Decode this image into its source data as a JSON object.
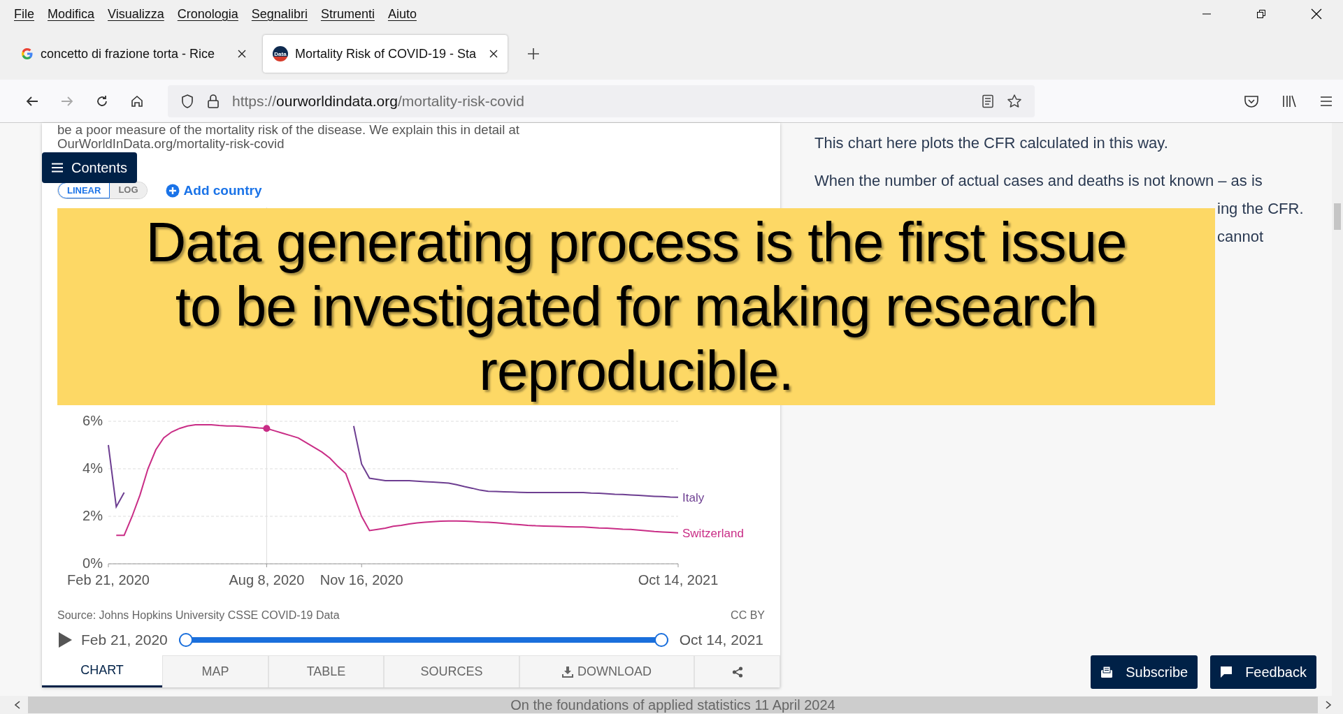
{
  "menu": [
    "File",
    "Modifica",
    "Visualizza",
    "Cronologia",
    "Segnalibri",
    "Strumenti",
    "Aiuto"
  ],
  "tabs": [
    {
      "title": "concetto di frazione torta - Rice",
      "selected": false
    },
    {
      "title": "Mortality Risk of COVID-19 - Sta",
      "selected": true,
      "favicon_text": "Data"
    }
  ],
  "address": {
    "scheme": "https://",
    "domain": "ourworldindata.org",
    "path": "/mortality-risk-covid"
  },
  "intro_lines": [
    "be a poor measure of the mortality risk of the disease. We explain this in detail at",
    "OurWorldInData.org/mortality-risk-covid"
  ],
  "contents_button": "Contents",
  "scale_toggle": [
    {
      "label": "LINEAR",
      "selected": true
    },
    {
      "label": "LOG",
      "selected": false
    }
  ],
  "add_country": "Add country",
  "chart_data": {
    "type": "line",
    "categories": [
      "Feb 21, 2020",
      null,
      null,
      null,
      null,
      null,
      null,
      null,
      null,
      null,
      null,
      null,
      null,
      null,
      null,
      null,
      null,
      null,
      null,
      null,
      "Aug 8, 2020",
      null,
      null,
      null,
      null,
      null,
      null,
      null,
      null,
      null,
      null,
      null,
      "Nov 16, 2020",
      null,
      null,
      null,
      null,
      null,
      null,
      null,
      null,
      null,
      null,
      null,
      null,
      null,
      null,
      null,
      null,
      null,
      null,
      null,
      null,
      null,
      null,
      null,
      null,
      null,
      null,
      null,
      null,
      null,
      null,
      null,
      null,
      null,
      null,
      null,
      null,
      null,
      null,
      null,
      "Oct 14, 2021"
    ],
    "yticks": [
      {
        "value": 0,
        "label": "0%"
      },
      {
        "value": 2,
        "label": "2%"
      },
      {
        "value": 4,
        "label": "4%"
      },
      {
        "value": 6,
        "label": "6%"
      }
    ],
    "ylim": [
      0,
      15
    ],
    "grid": true,
    "series": [
      {
        "name": "Italy",
        "color": "#6d3e91",
        "values": [
          5.0,
          2.4,
          3.0,
          null,
          null,
          null,
          null,
          null,
          null,
          null,
          null,
          null,
          null,
          null,
          null,
          null,
          null,
          null,
          null,
          null,
          null,
          null,
          null,
          null,
          null,
          null,
          null,
          null,
          null,
          null,
          null,
          5.8,
          4.2,
          3.6,
          3.55,
          3.5,
          3.5,
          3.5,
          3.5,
          3.48,
          3.46,
          3.44,
          3.42,
          3.4,
          3.33,
          3.25,
          3.18,
          3.1,
          3.05,
          3.04,
          3.03,
          3.02,
          3.01,
          3.0,
          3.0,
          3.0,
          3.0,
          3.0,
          3.0,
          3.0,
          3.0,
          2.98,
          2.97,
          2.95,
          2.93,
          2.92,
          2.9,
          2.88,
          2.86,
          2.84,
          2.83,
          2.81,
          2.8
        ]
      },
      {
        "name": "Switzerland",
        "color": "#c92d86",
        "values": [
          null,
          1.2,
          1.2,
          2.0,
          2.9,
          4.0,
          4.8,
          5.3,
          5.55,
          5.7,
          5.8,
          5.85,
          5.85,
          5.85,
          5.82,
          5.8,
          5.8,
          5.78,
          5.75,
          5.72,
          5.7,
          5.6,
          5.5,
          5.4,
          5.3,
          5.1,
          4.9,
          4.7,
          4.45,
          4.1,
          3.8,
          2.9,
          2.0,
          1.4,
          1.45,
          1.5,
          1.58,
          1.62,
          1.68,
          1.72,
          1.75,
          1.77,
          1.79,
          1.8,
          1.8,
          1.79,
          1.78,
          1.76,
          1.75,
          1.73,
          1.7,
          1.67,
          1.65,
          1.62,
          1.6,
          1.59,
          1.58,
          1.57,
          1.56,
          1.55,
          1.55,
          1.53,
          1.51,
          1.5,
          1.48,
          1.46,
          1.45,
          1.42,
          1.39,
          1.36,
          1.34,
          1.32,
          1.3
        ]
      }
    ]
  },
  "source": "Source: Johns Hopkins University CSSE COVID-19 Data",
  "license": "CC BY",
  "timeline": {
    "start": "Feb 21, 2020",
    "end": "Oct 14, 2021",
    "level": 1
  },
  "chart_tabs": [
    {
      "label": "CHART",
      "selected": true,
      "kind": "text"
    },
    {
      "label": "MAP",
      "selected": false,
      "kind": "text"
    },
    {
      "label": "TABLE",
      "selected": false,
      "kind": "text"
    },
    {
      "label": "SOURCES",
      "selected": false,
      "kind": "text"
    },
    {
      "label": "DOWNLOAD",
      "selected": false,
      "kind": "download"
    },
    {
      "selected": false,
      "kind": "share"
    }
  ],
  "article_right": [
    "This chart here plots the CFR calculated in this way.",
    "When the number of actual cases and deaths is not known – as is"
  ],
  "article_right_fragments": [
    "ing the CFR.",
    "cannot"
  ],
  "banner": "Data generating process is the first issue\nto be investigated for making research\nreproducible.",
  "footer_buttons": [
    {
      "label": "Subscribe",
      "kind": "subscribe"
    },
    {
      "label": "Feedback",
      "kind": "feedback"
    }
  ],
  "slide_footer": "On the foundations of applied statistics 11 April 2024"
}
